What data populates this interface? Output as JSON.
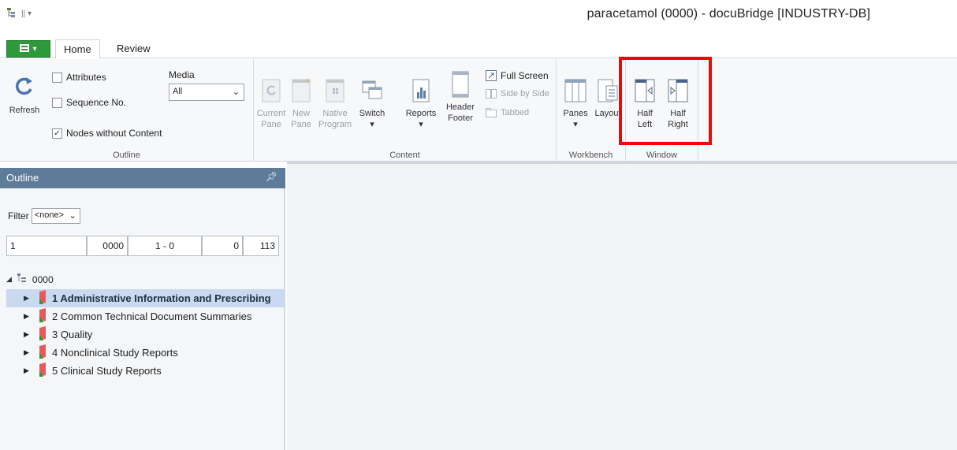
{
  "window": {
    "title": "paracetamol (0000) - docuBridge [INDUSTRY-DB]"
  },
  "tabs": [
    {
      "label": "Home",
      "active": true
    },
    {
      "label": "Review",
      "active": false
    }
  ],
  "ribbon": {
    "refresh_label": "Refresh",
    "outline_group": {
      "checkboxes": [
        {
          "label": "Attributes",
          "checked": false
        },
        {
          "label": "Sequence No.",
          "checked": false
        },
        {
          "label": "Nodes without Content",
          "checked": true
        }
      ],
      "media_label": "Media",
      "media_value": "All",
      "group_label": "Outline"
    },
    "content_group": {
      "buttons": [
        {
          "line1": "Current",
          "line2": "Pane"
        },
        {
          "line1": "New",
          "line2": "Pane"
        },
        {
          "line1": "Native",
          "line2": "Program"
        },
        {
          "line1": "Switch",
          "line2": "▾"
        },
        {
          "line1": "Reports",
          "line2": "▾"
        },
        {
          "line1": "Header",
          "line2": "Footer"
        }
      ],
      "view_options": [
        "Full Screen",
        "Side by Side",
        "Tabbed"
      ],
      "group_label": "Content"
    },
    "workbench_group": {
      "buttons": [
        {
          "line1": "Panes",
          "line2": "▾"
        },
        {
          "line1": "Layout",
          "line2": ""
        }
      ],
      "group_label": "Workbench"
    },
    "window_group": {
      "buttons": [
        {
          "line1": "Half",
          "line2": "Left"
        },
        {
          "line1": "Half",
          "line2": "Right"
        }
      ],
      "group_label": "Window"
    }
  },
  "outline_panel": {
    "title": "Outline",
    "filter_label": "Filter",
    "filter_value": "<none>",
    "fields": [
      "1",
      "0000",
      "1 - 0",
      "0",
      "113"
    ],
    "root_label": "0000",
    "items": [
      {
        "label": "1 Administrative Information and Prescribing",
        "selected": true
      },
      {
        "label": "2 Common Technical Document Summaries",
        "selected": false
      },
      {
        "label": "3 Quality",
        "selected": false
      },
      {
        "label": "4 Nonclinical Study Reports",
        "selected": false
      },
      {
        "label": "5 Clinical Study Reports",
        "selected": false
      }
    ]
  },
  "colors": {
    "highlight": "#ff0000",
    "panel_header": "#5e7b9a",
    "file_button": "#2d9a3a",
    "selection": "#c9d9ef"
  }
}
